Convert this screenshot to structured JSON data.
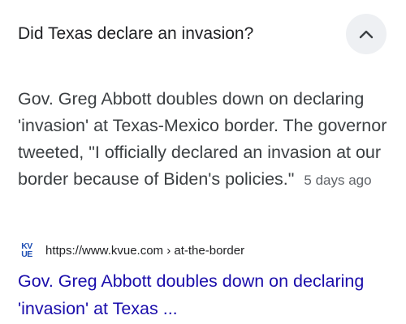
{
  "question": {
    "text": "Did Texas declare an invasion?",
    "toggle_icon": "chevron-up-icon"
  },
  "snippet": {
    "text": "Gov. Greg Abbott doubles down on declaring 'invasion' at Texas-Mexico border. The governor tweeted, \"I officially declared an invasion at our border because of Biden's policies.\"",
    "date": "5 days ago"
  },
  "source": {
    "favicon_top": "KV",
    "favicon_bottom": "UE",
    "url": "https://www.kvue.com › at-the-border"
  },
  "result": {
    "title": "Gov. Greg Abbott doubles down on declaring 'invasion' at Texas ..."
  },
  "colors": {
    "link": "#1a0dab",
    "favicon": "#1f4fb4",
    "button_bg": "#eef0f3"
  }
}
